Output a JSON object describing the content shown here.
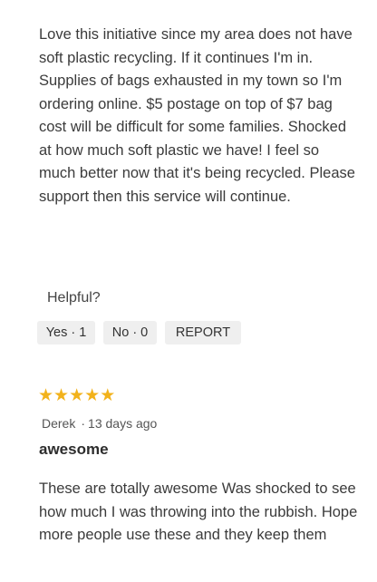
{
  "reviews": [
    {
      "body": "Love this initiative since my area does not have soft plastic recycling. If it continues I'm in. Supplies of bags exhausted in my town so I'm ordering online. $5 postage on top of $7 bag cost will be difficult for some families. Shocked at how much soft plastic we have! I feel so much better now that it's being recycled. Please support then this service will continue.",
      "helpful": {
        "label": "Helpful?",
        "yes": "Yes · 1",
        "no": "No · 0",
        "report": "REPORT"
      }
    },
    {
      "rating": 5,
      "stars_color": "#f2b21b",
      "author": "Derek",
      "separator": "·",
      "date": "13 days ago",
      "title": "awesome",
      "body": "These are totally awesome Was shocked to see how much I was throwing into the rubbish. Hope more people use these and they keep them"
    }
  ]
}
